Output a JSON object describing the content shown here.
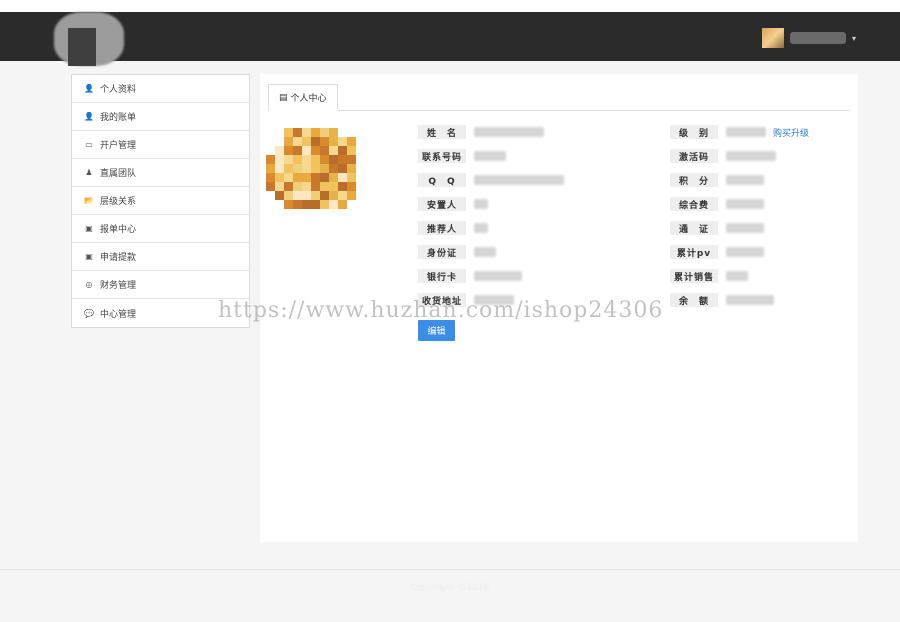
{
  "nav": {
    "caret": "▾"
  },
  "sidebar": {
    "items": [
      {
        "label": "个人资料",
        "icon": "user-icon",
        "glyph": "👤"
      },
      {
        "label": "我的账单",
        "icon": "user-icon",
        "glyph": "👤"
      },
      {
        "label": "开户管理",
        "icon": "card-icon",
        "glyph": "▭"
      },
      {
        "label": "直属团队",
        "icon": "person-icon",
        "glyph": "♟"
      },
      {
        "label": "层级关系",
        "icon": "folder-open-icon",
        "glyph": "📂"
      },
      {
        "label": "报单中心",
        "icon": "money-icon",
        "glyph": "▣"
      },
      {
        "label": "申请提款",
        "icon": "money-icon",
        "glyph": "▣"
      },
      {
        "label": "财务管理",
        "icon": "circle-target-icon",
        "glyph": "◎"
      },
      {
        "label": "中心管理",
        "icon": "comments-icon",
        "glyph": "💬"
      }
    ]
  },
  "panel": {
    "tab_label": "个人中心",
    "tab_icon": "id-card-icon",
    "tab_glyph": "▤",
    "left_fields": [
      {
        "label": "姓　名"
      },
      {
        "label": "联系号码"
      },
      {
        "label": "Q　Q"
      },
      {
        "label": "安置人"
      },
      {
        "label": "推荐人"
      },
      {
        "label": "身份证"
      },
      {
        "label": "银行卡"
      },
      {
        "label": "收货地址"
      }
    ],
    "right_fields": [
      {
        "label": "级　别"
      },
      {
        "label": "激活码"
      },
      {
        "label": "积　分"
      },
      {
        "label": "综合费"
      },
      {
        "label": "通　证"
      },
      {
        "label": "累计pv"
      },
      {
        "label": "累计销售"
      },
      {
        "label": "余　额"
      }
    ],
    "upgrade_link": "购买升级",
    "edit_button": "编辑"
  },
  "watermark": "https://www.huzhan.com/ishop24306",
  "footer": {
    "text": "Copyright ©2016"
  }
}
